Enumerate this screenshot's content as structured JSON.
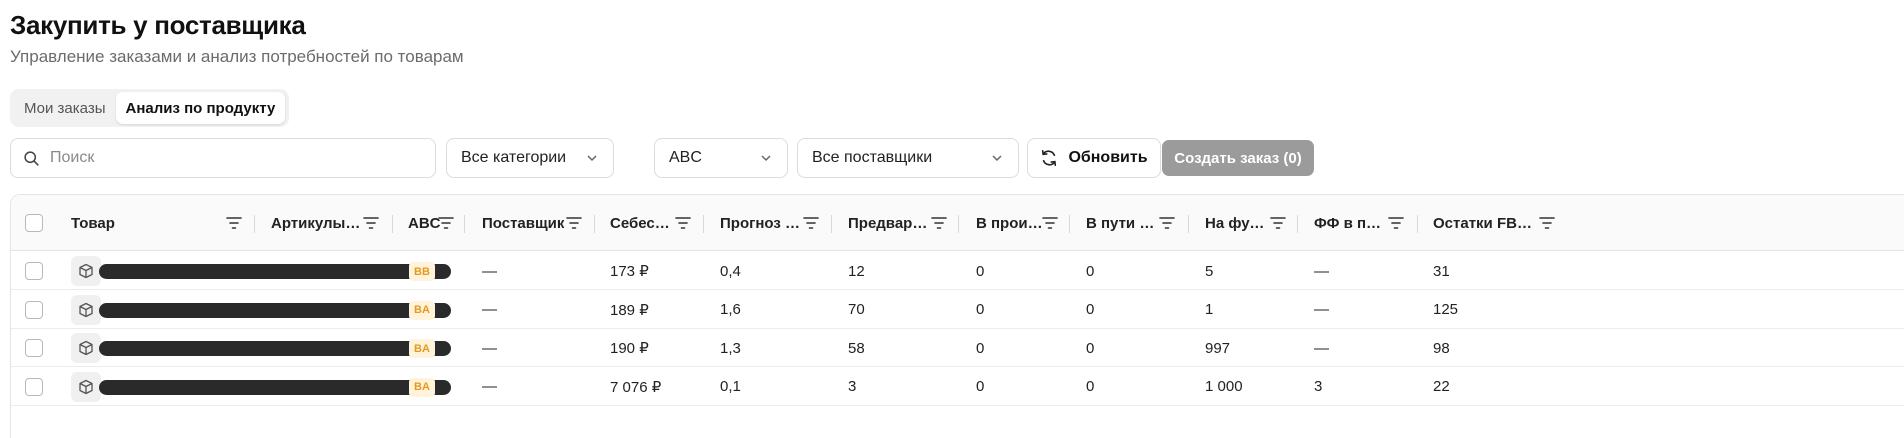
{
  "page": {
    "title": "Закупить у поставщика",
    "subtitle": "Управление заказами и анализ потребностей по товарам"
  },
  "tabs": [
    {
      "label": "Мои заказы",
      "active": false
    },
    {
      "label": "Анализ по продукту",
      "active": true
    }
  ],
  "toolbar": {
    "search_placeholder": "Поиск",
    "category_select": "Все категории",
    "abc_select": "ABC",
    "supplier_select": "Все поставщики",
    "refresh_label": "Обновить",
    "create_order_label": "Создать заказ (0)"
  },
  "table": {
    "columns": [
      "Товар",
      "Артикулы в с...",
      "ABC",
      "Поставщик",
      "Себесто...",
      "Прогноз пр...",
      "Предварит. ...",
      "В произв...",
      "В пути от ...",
      "На фулф...",
      "ФФ в пути...",
      "Остатки FBO на ..."
    ],
    "rows": [
      {
        "abc": "BB",
        "supplier": "—",
        "cost": "173 ₽",
        "forecast": "0,4",
        "preliminary": "12",
        "in_production": "0",
        "in_transit": "0",
        "at_fulfillment": "5",
        "ff_in_transit": "—",
        "fbo_stock": "31"
      },
      {
        "abc": "BA",
        "supplier": "—",
        "cost": "189 ₽",
        "forecast": "1,6",
        "preliminary": "70",
        "in_production": "0",
        "in_transit": "0",
        "at_fulfillment": "1",
        "ff_in_transit": "—",
        "fbo_stock": "125"
      },
      {
        "abc": "BA",
        "supplier": "—",
        "cost": "190 ₽",
        "forecast": "1,3",
        "preliminary": "58",
        "in_production": "0",
        "in_transit": "0",
        "at_fulfillment": "997",
        "ff_in_transit": "—",
        "fbo_stock": "98"
      },
      {
        "abc": "BA",
        "supplier": "—",
        "cost": "7 076 ₽",
        "forecast": "0,1",
        "preliminary": "3",
        "in_production": "0",
        "in_transit": "0",
        "at_fulfillment": "1 000",
        "ff_in_transit": "3",
        "fbo_stock": "22"
      }
    ]
  },
  "colors": {
    "badge_bg": "#fff3dc",
    "badge_text": "#e59a1c",
    "create_button_disabled": "#9b9b9b"
  },
  "icons": {
    "search": "search-icon",
    "chevron": "chevron-down-icon",
    "refresh": "refresh-icon",
    "filter": "filter-icon",
    "product": "package-icon"
  }
}
